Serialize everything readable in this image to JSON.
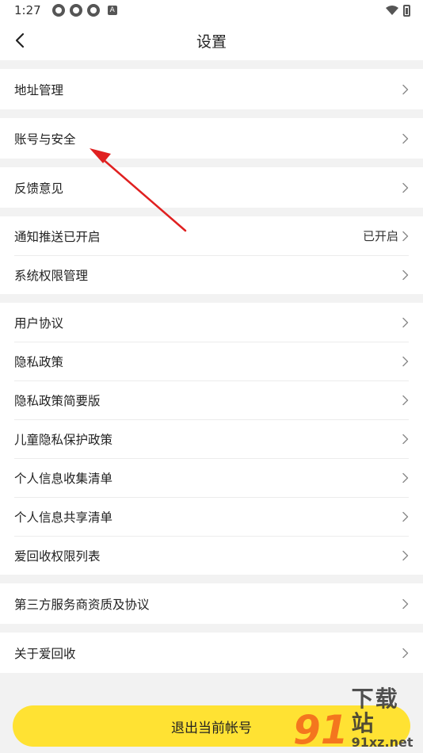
{
  "status": {
    "time": "1:27",
    "notif_badge": "A"
  },
  "header": {
    "title": "设置"
  },
  "groups": [
    {
      "items": [
        {
          "label": "地址管理"
        }
      ]
    },
    {
      "items": [
        {
          "label": "账号与安全"
        }
      ]
    },
    {
      "items": [
        {
          "label": "反馈意见"
        }
      ]
    },
    {
      "items": [
        {
          "label": "通知推送已开启",
          "value": "已开启"
        },
        {
          "label": "系统权限管理"
        }
      ]
    },
    {
      "items": [
        {
          "label": "用户协议"
        },
        {
          "label": "隐私政策"
        },
        {
          "label": "隐私政策简要版"
        },
        {
          "label": "儿童隐私保护政策"
        },
        {
          "label": "个人信息收集清单"
        },
        {
          "label": "个人信息共享清单"
        },
        {
          "label": "爱回收权限列表"
        }
      ]
    },
    {
      "items": [
        {
          "label": "第三方服务商资质及协议"
        }
      ]
    },
    {
      "items": [
        {
          "label": "关于爱回收"
        }
      ]
    }
  ],
  "logout": {
    "label": "退出当前帐号"
  },
  "watermark": {
    "logo": "91",
    "name": "下载站",
    "url": "91xz.net"
  },
  "colors": {
    "accent": "#ffe233",
    "annotation_arrow": "#e02020",
    "watermark_orange": "#f36b1c"
  }
}
